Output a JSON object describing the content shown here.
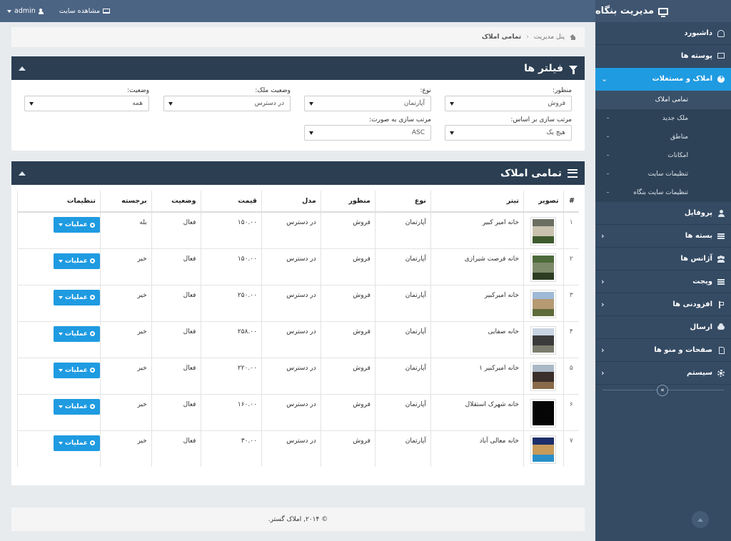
{
  "topbar": {
    "brand": "مدیریت بنگاه",
    "user": "admin",
    "view_site": "مشاهده سایت"
  },
  "sidebar": {
    "items": [
      {
        "label": "داشبورد",
        "icon": "dashboard-icon"
      },
      {
        "label": "پوسته ها",
        "icon": "monitor-icon"
      },
      {
        "label": "املاک و مستغلات",
        "icon": "plus-circle-icon",
        "active": true
      },
      {
        "label": "پروفایل",
        "icon": "user-icon"
      },
      {
        "label": "بسته ها",
        "icon": "bars-icon"
      },
      {
        "label": "آژانس ها",
        "icon": "users-icon"
      },
      {
        "label": "ویجت",
        "icon": "bars-icon"
      },
      {
        "label": "افزودنی ها",
        "icon": "plug-icon"
      },
      {
        "label": "ارسال",
        "icon": "cloud-icon"
      },
      {
        "label": "صفحات و منو ها",
        "icon": "file-icon"
      },
      {
        "label": "سیستم",
        "icon": "gear-icon"
      }
    ],
    "subitems": [
      "تمامی املاک",
      "ملک جدید",
      "مناطق",
      "امکانات",
      "تنظیمات سایت",
      "تنظیمات سایت بنگاه"
    ]
  },
  "breadcrumb": {
    "home": "پنل مدیریت",
    "current": "تمامی املاک"
  },
  "filters": {
    "title": "فیلتر ها",
    "fields": [
      {
        "label": "منظور:",
        "value": "فروش"
      },
      {
        "label": "نوع:",
        "value": "آپارتمان"
      },
      {
        "label": "وضعیت ملک:",
        "value": "در دسترس"
      },
      {
        "label": "وضعیت:",
        "value": "همه"
      },
      {
        "label": "مرتب سازی بر اساس:",
        "value": "هیچ یک"
      },
      {
        "label": "مرتب سازی به صورت:",
        "value": "ASC"
      }
    ]
  },
  "table": {
    "title": "تمامی املاک",
    "headers": [
      "#",
      "تصویر",
      "تیتر",
      "نوع",
      "منظور",
      "مدل",
      "قیمت",
      "وضعیت",
      "برجسته",
      "تنظیمات"
    ],
    "action_label": "عملیات",
    "rows": [
      {
        "n": "۱",
        "title": "خانه امیر کبیر",
        "type": "آپارتمان",
        "purpose": "فروش",
        "model": "در دسترس",
        "price": "۱۵۰.۰۰",
        "status": "فعال",
        "featured": "بله",
        "thumb": [
          "#6b6f62",
          "#c9c2ae",
          "#3e5a2e"
        ]
      },
      {
        "n": "۲",
        "title": "خانه فرصت شیرازی",
        "type": "آپارتمان",
        "purpose": "فروش",
        "model": "در دسترس",
        "price": "۱۵۰.۰۰",
        "status": "فعال",
        "featured": "خیر",
        "thumb": [
          "#4d6b3a",
          "#7d8a6a",
          "#2c3d22"
        ]
      },
      {
        "n": "۳",
        "title": "خانه امیرکبیر",
        "type": "آپارتمان",
        "purpose": "فروش",
        "model": "در دسترس",
        "price": "۲۵۰.۰۰",
        "status": "فعال",
        "featured": "خیر",
        "thumb": [
          "#9fb9d6",
          "#b69a72",
          "#5d6a3a"
        ]
      },
      {
        "n": "۴",
        "title": "خانه صفایی",
        "type": "آپارتمان",
        "purpose": "فروش",
        "model": "در دسترس",
        "price": "۲۵۸.۰۰",
        "status": "فعال",
        "featured": "خیر",
        "thumb": [
          "#c8d4e2",
          "#3b3b3b",
          "#7c7c6e"
        ]
      },
      {
        "n": "۵",
        "title": "خانه امیرکبیر ۱",
        "type": "آپارتمان",
        "purpose": "فروش",
        "model": "در دسترس",
        "price": "۲۲۰.۰۰",
        "status": "فعال",
        "featured": "خیر",
        "thumb": [
          "#aab8c6",
          "#3a2f2a",
          "#8a6a4a"
        ]
      },
      {
        "n": "۶",
        "title": "خانه شهرک استقلال",
        "type": "آپارتمان",
        "purpose": "فروش",
        "model": "در دسترس",
        "price": "۱۶۰.۰۰",
        "status": "فعال",
        "featured": "خیر",
        "thumb": [
          "#050505",
          "#050505",
          "#050505"
        ]
      },
      {
        "n": "۷",
        "title": "خانه معالی آباد",
        "type": "آپارتمان",
        "purpose": "فروش",
        "model": "در دسترس",
        "price": "۳۰.۰۰",
        "status": "فعال",
        "featured": "خیر",
        "thumb": [
          "#1d2f6a",
          "#c79a5a",
          "#2a8fc7"
        ]
      }
    ]
  },
  "footer": "© ۲۰۱۴, املاک گستر."
}
